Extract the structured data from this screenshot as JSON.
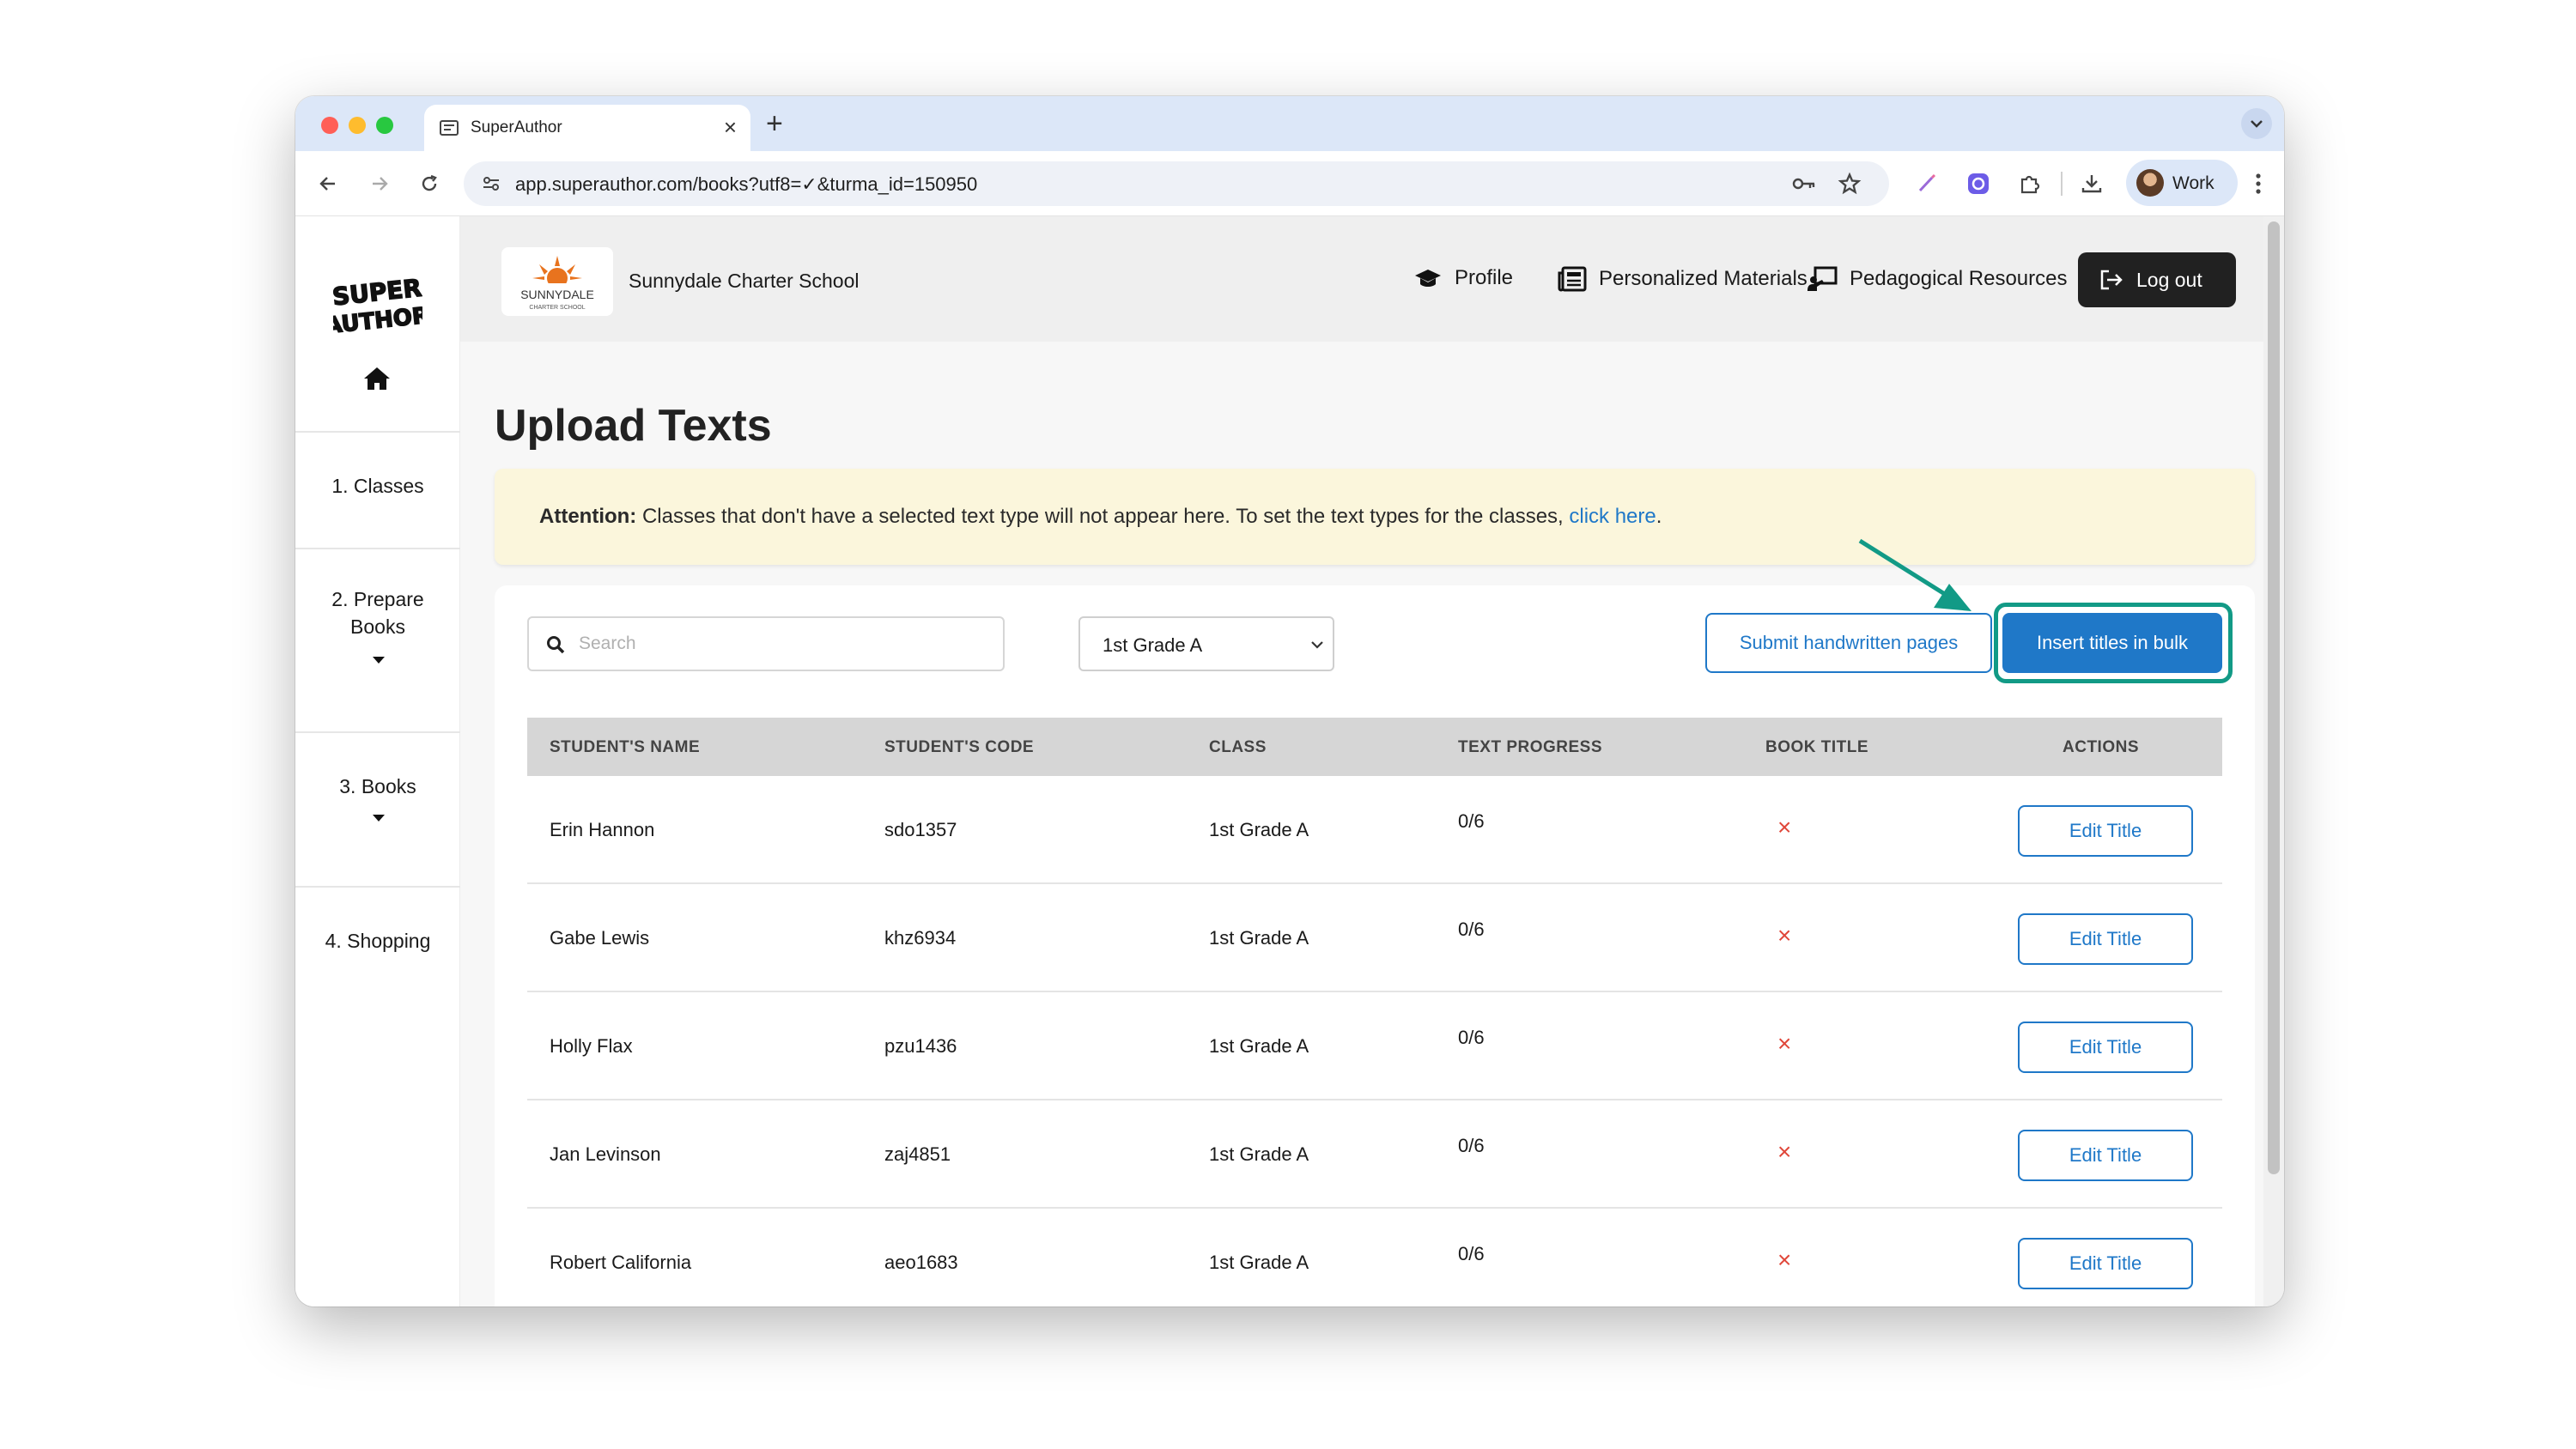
{
  "browser": {
    "tab_title": "SuperAuthor",
    "new_tab": "+",
    "tab_close": "×",
    "url": "app.superauthor.com/books?utf8=✓&turma_id=150950",
    "profile_label": "Work"
  },
  "sidebar": {
    "logo_text": "SUPER AUTHOR",
    "items": [
      {
        "label": "1. Classes"
      },
      {
        "label": "2. Prepare Books"
      },
      {
        "label": "3. Books"
      },
      {
        "label": "4. Shopping"
      }
    ]
  },
  "header": {
    "school_logo_text": "SUNNYDALE",
    "school_logo_subtext": "CHARTER SCHOOL",
    "school_name": "Sunnydale Charter School",
    "nav": {
      "profile": "Profile",
      "personalized_materials": "Personalized Materials",
      "pedagogical_resources": "Pedagogical Resources",
      "logout": "Log out"
    }
  },
  "main": {
    "title": "Upload Texts",
    "alert": {
      "label": "Attention:",
      "text": "Classes that don't have a selected text type will not appear here. To set the text types for the classes,",
      "link": "click here",
      "suffix": "."
    },
    "search_placeholder": "Search",
    "class_select": "1st Grade A",
    "submit_button": "Submit handwritten pages",
    "bulk_button": "Insert titles in bulk",
    "table": {
      "headers": [
        "STUDENT'S NAME",
        "STUDENT'S CODE",
        "CLASS",
        "TEXT PROGRESS",
        "BOOK TITLE",
        "ACTIONS"
      ],
      "rows": [
        {
          "name": "Erin Hannon",
          "code": "sdo1357",
          "class": "1st Grade A",
          "progress": "0/6",
          "book_title": "×",
          "action": "Edit Title"
        },
        {
          "name": "Gabe Lewis",
          "code": "khz6934",
          "class": "1st Grade A",
          "progress": "0/6",
          "book_title": "×",
          "action": "Edit Title"
        },
        {
          "name": "Holly Flax",
          "code": "pzu1436",
          "class": "1st Grade A",
          "progress": "0/6",
          "book_title": "×",
          "action": "Edit Title"
        },
        {
          "name": "Jan Levinson",
          "code": "zaj4851",
          "class": "1st Grade A",
          "progress": "0/6",
          "book_title": "×",
          "action": "Edit Title"
        },
        {
          "name": "Robert California",
          "code": "aeo1683",
          "class": "1st Grade A",
          "progress": "0/6",
          "book_title": "×",
          "action": "Edit Title"
        }
      ]
    }
  },
  "colors": {
    "accent": "#1f78c8",
    "highlight": "#129a86",
    "alert_bg": "#fbf6dc",
    "error": "#e0473a"
  }
}
